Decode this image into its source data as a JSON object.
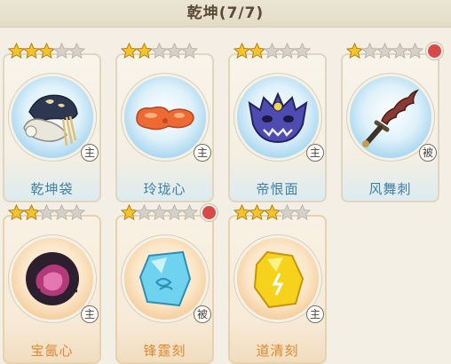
{
  "header": {
    "title": "乾坤(7/7)"
  },
  "colors": {
    "star_filled": "#f4c32a",
    "star_empty": "#d5d1c8",
    "name_blue": "#3f7fa6",
    "name_orange": "#e0892e",
    "dot": "#d84a4a"
  },
  "items": [
    {
      "name": "乾坤袋",
      "stars_filled": 3,
      "stars_total": 5,
      "badge": "主",
      "dot": false,
      "icon": "bag-icon",
      "theme": "blue"
    },
    {
      "name": "玲珑心",
      "stars_filled": 2,
      "stars_total": 5,
      "badge": "主",
      "dot": false,
      "icon": "orange-heart-icon",
      "theme": "blue"
    },
    {
      "name": "帝恨面",
      "stars_filled": 2,
      "stars_total": 5,
      "badge": "主",
      "dot": false,
      "icon": "demon-mask-icon",
      "theme": "blue"
    },
    {
      "name": "风舞刺",
      "stars_filled": 1,
      "stars_total": 5,
      "badge": "被",
      "dot": true,
      "icon": "dagger-icon",
      "theme": "blue"
    },
    {
      "name": "宝氤心",
      "stars_filled": 2,
      "stars_total": 5,
      "badge": "主",
      "dot": false,
      "icon": "purple-orb-icon",
      "theme": "orange"
    },
    {
      "name": "锋霆刻",
      "stars_filled": 1,
      "stars_total": 5,
      "badge": "被",
      "dot": true,
      "icon": "blue-crystal-icon",
      "theme": "orange"
    },
    {
      "name": "道清刻",
      "stars_filled": 3,
      "stars_total": 5,
      "badge": "主",
      "dot": false,
      "icon": "yellow-stone-icon",
      "theme": "orange"
    }
  ]
}
